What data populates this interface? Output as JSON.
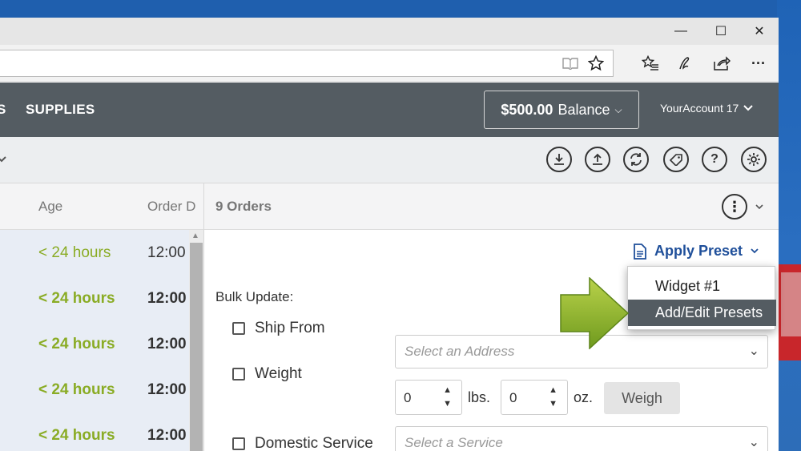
{
  "window": {
    "minimize_glyph": "—",
    "maximize_glyph": "☐",
    "close_glyph": "✕"
  },
  "toolbar_icons": [
    "reading-view-icon",
    "favorite-star-icon",
    "favorites-hub-icon",
    "pen-notes-icon",
    "share-icon",
    "more-icon"
  ],
  "more_glyph": "···",
  "nav": {
    "partial_item": "S",
    "supplies": "SUPPLIES"
  },
  "balance": {
    "amount": "$500.00",
    "label": "Balance"
  },
  "account": {
    "name": "YourAccount 17"
  },
  "action_icons": [
    "download-icon",
    "upload-icon",
    "refresh-icon",
    "label-icon",
    "help-icon",
    "settings-icon"
  ],
  "columns": {
    "age": "Age",
    "order_date": "Order D"
  },
  "rows": [
    {
      "age": "< 24 hours",
      "time": "12:00",
      "bold": false
    },
    {
      "age": "< 24 hours",
      "time": "12:00",
      "bold": true
    },
    {
      "age": "< 24 hours",
      "time": "12:00",
      "bold": true
    },
    {
      "age": "< 24 hours",
      "time": "12:00",
      "bold": true
    },
    {
      "age": "< 24 hours",
      "time": "12:00",
      "bold": true
    }
  ],
  "orders": {
    "count_label": "9 Orders"
  },
  "preset": {
    "label": "Apply Preset",
    "items": [
      "Widget #1",
      "Add/Edit Presets"
    ],
    "selected": "Add/Edit Presets"
  },
  "bulk": {
    "title": "Bulk Update:",
    "ship_from_label": "Ship From",
    "ship_from_placeholder": "Select an Address",
    "weight_label": "Weight",
    "lbs_value": "0",
    "lbs_unit": "lbs.",
    "oz_value": "0",
    "oz_unit": "oz.",
    "weigh_button": "Weigh",
    "service_label": "Domestic Service",
    "service_placeholder": "Select a Service"
  },
  "colors": {
    "appbar": "#545c62",
    "accent_green": "#8aac25",
    "link_blue": "#1f4f9a",
    "arrow_green": "#8db52a"
  }
}
